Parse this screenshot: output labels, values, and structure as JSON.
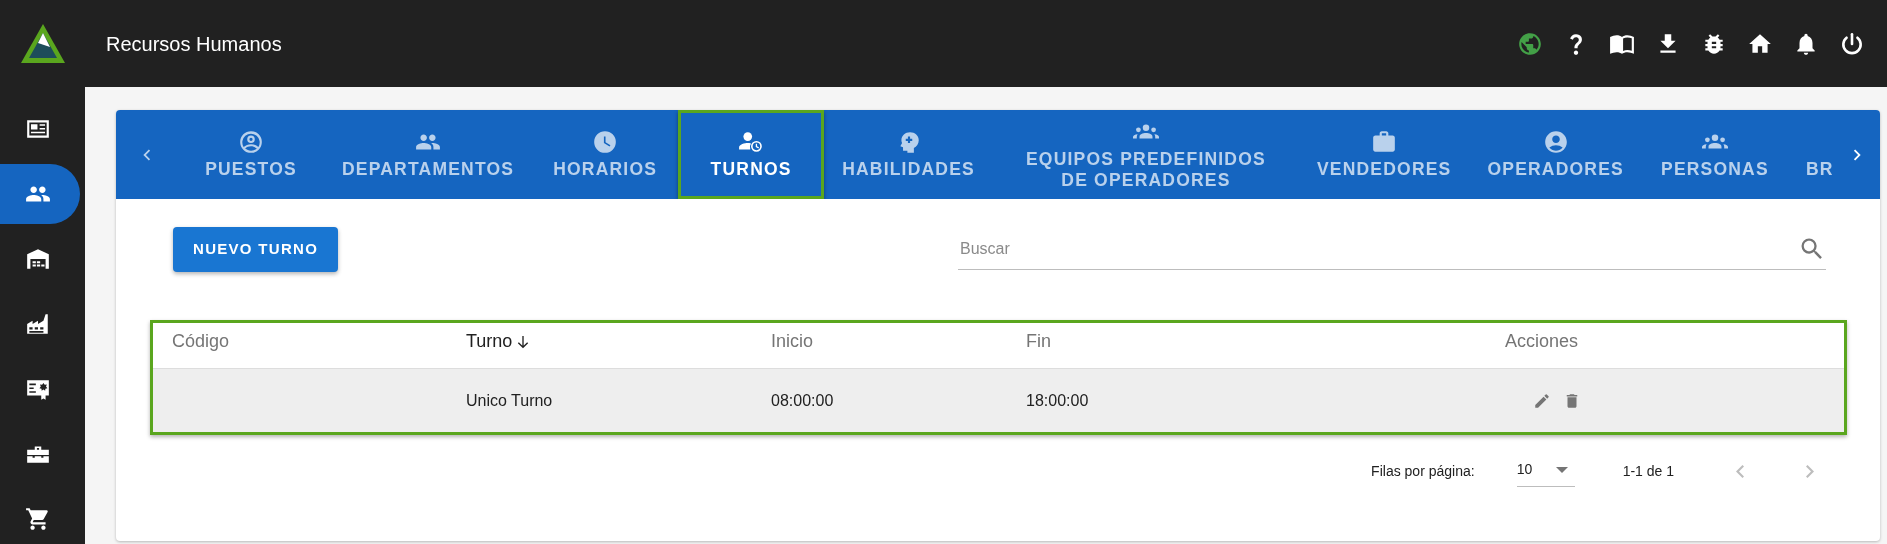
{
  "app": {
    "title": "Recursos Humanos"
  },
  "sidebar": {
    "items": [
      {
        "selected": false
      },
      {
        "selected": true
      },
      {
        "selected": false
      },
      {
        "selected": false
      },
      {
        "selected": false
      },
      {
        "selected": false
      },
      {
        "selected": false
      }
    ]
  },
  "tabs": [
    {
      "label": "PUESTOS",
      "selected": false
    },
    {
      "label": "DEPARTAMENTOS",
      "selected": false
    },
    {
      "label": "HORARIOS",
      "selected": false
    },
    {
      "label": "TURNOS",
      "selected": true
    },
    {
      "label": "HABILIDADES",
      "selected": false
    },
    {
      "label": "EQUIPOS PREDEFINIDOS DE OPERADORES",
      "selected": false
    },
    {
      "label": "VENDEDORES",
      "selected": false
    },
    {
      "label": "OPERADORES",
      "selected": false
    },
    {
      "label": "PERSONAS",
      "selected": false
    },
    {
      "label": "BR",
      "selected": false
    }
  ],
  "new_button": "NUEVO TURNO",
  "search": {
    "placeholder": "Buscar"
  },
  "table": {
    "columns": [
      {
        "label": "Código",
        "sorted": false
      },
      {
        "label": "Turno",
        "sorted": true
      },
      {
        "label": "Inicio",
        "sorted": false
      },
      {
        "label": "Fin",
        "sorted": false
      },
      {
        "label": "Acciones",
        "sorted": false
      }
    ],
    "rows": [
      {
        "turno": "Unico Turno",
        "inicio": "08:00:00",
        "fin": "18:00:00"
      }
    ]
  },
  "pagination": {
    "rows_label": "Filas por página:",
    "rows_per_page": "10",
    "range": "1-1 de 1"
  }
}
